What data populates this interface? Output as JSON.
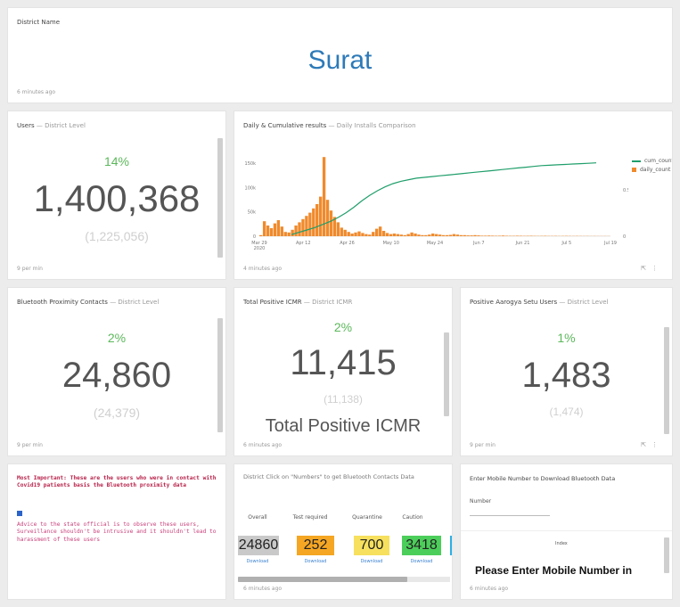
{
  "district_card": {
    "title": "District Name",
    "value": "Surat",
    "footer": "6 minutes ago"
  },
  "users_card": {
    "title": "Users",
    "subtitle": "District Level",
    "percent": "14%",
    "value": "1,400,368",
    "previous": "(1,225,056)",
    "footer": "9 per min"
  },
  "chart_card": {
    "title": "Daily & Cumulative results",
    "subtitle": "Daily Installs Comparison",
    "footer": "4 minutes ago",
    "icons": [
      "expand-icon",
      "more-icon"
    ]
  },
  "chart_data": {
    "type": "bar",
    "x_tick_labels": [
      "Mar 29\n2020",
      "Apr 12",
      "Apr 26",
      "May 10",
      "May 24",
      "Jun 7",
      "Jun 21",
      "Jul 5",
      "Jul 19"
    ],
    "y_left_ticks": [
      "150k",
      "100k",
      "50k",
      "0"
    ],
    "y_right_ticks": [
      "0.5M",
      "0"
    ],
    "legend": [
      "cum_count",
      "daily_count"
    ],
    "colors": {
      "cum_count": "#1f9e6b",
      "daily_count": "#f08a2c"
    },
    "daily_values": [
      2000,
      28000,
      20000,
      15000,
      24000,
      30000,
      18000,
      8000,
      7000,
      12000,
      20000,
      26000,
      32000,
      38000,
      44000,
      52000,
      60000,
      74000,
      148000,
      68000,
      48000,
      36000,
      26000,
      16000,
      12000,
      8000,
      5000,
      7000,
      9000,
      6000,
      4000,
      3000,
      8000,
      14000,
      18000,
      10000,
      6000,
      4000,
      5000,
      4000,
      3000,
      2000,
      4000,
      7000,
      5000,
      3000,
      2000,
      2000,
      3000,
      5000,
      4000,
      3000,
      2000,
      2000,
      2500,
      4000,
      3000,
      2000,
      2000,
      1500,
      1500,
      2000,
      1500,
      1000,
      1000,
      1200,
      1000,
      800,
      900,
      1200,
      800,
      700,
      700,
      900,
      800,
      600,
      700,
      800,
      600,
      500,
      600,
      700,
      500,
      500,
      600,
      400,
      500,
      600,
      450,
      400,
      500,
      400,
      350,
      400,
      300,
      350,
      300,
      250,
      300,
      250
    ],
    "cum_values": [
      0.02,
      0.05,
      0.08,
      0.11,
      0.15,
      0.19,
      0.24,
      0.3,
      0.37,
      0.45,
      0.52,
      0.58,
      0.63,
      0.67,
      0.7,
      0.72,
      0.74,
      0.75,
      0.76,
      0.77,
      0.78,
      0.79,
      0.8,
      0.81,
      0.82,
      0.83,
      0.84,
      0.85,
      0.86,
      0.87,
      0.88,
      0.89,
      0.9,
      0.905,
      0.91,
      0.915,
      0.92,
      0.925,
      0.93,
      0.935
    ]
  },
  "bluetooth_card": {
    "title": "Bluetooth Proximity Contacts",
    "subtitle": "District Level",
    "percent": "2%",
    "value": "24,860",
    "previous": "(24,379)",
    "footer": "9 per min"
  },
  "icmr_card": {
    "title": "Total Positive ICMR",
    "subtitle": "District ICMR",
    "percent": "2%",
    "value": "11,415",
    "previous": "(11,138)",
    "caption": "Total Positive ICMR",
    "footer": "6 minutes ago"
  },
  "aarogya_card": {
    "title": "Positive Aarogya Setu Users",
    "subtitle": "District Level",
    "percent": "1%",
    "value": "1,483",
    "previous": "(1,474)",
    "footer": "9 per min"
  },
  "notes_card": {
    "warning": "Most Important: These are the users who were in contact with Covid19 patients basis the Bluetooth proximity data",
    "advice": "Advice to the state official is to observe these users, Surveillance shouldn't be intrusive and it shouldn't lead to harassment of these users"
  },
  "table_card": {
    "title": "District Click on \"Numbers\" to get Bluetooth Contacts Data",
    "columns": [
      "Overall",
      "Test required",
      "Quarantine",
      "Caution"
    ],
    "values": [
      "24860",
      "252",
      "700",
      "3418"
    ],
    "value_colors": [
      "#c9c9c9",
      "#f5a623",
      "#f6e05e",
      "#4cce5a"
    ],
    "link_label": "Download",
    "footer": "6 minutes ago"
  },
  "download_card": {
    "title": "Enter Mobile Number to Download Bluetooth Data",
    "field_label": "Number",
    "inner_label": "Index",
    "prompt": "Please Enter Mobile Number in",
    "footer": "6 minutes ago"
  }
}
